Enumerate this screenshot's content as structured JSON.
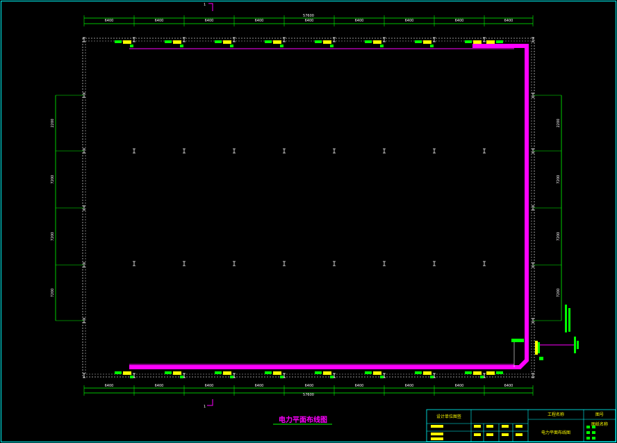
{
  "drawing": {
    "title": "电力平面布线图",
    "background": "#000000",
    "colors": {
      "border": "#00ffff",
      "dimension": "#00ff00",
      "cable": "#ff00ff",
      "equipment_a": "#ffff00",
      "equipment_b": "#00ff00",
      "text": "#ffffff"
    }
  },
  "dimensions": {
    "top_total": "57600",
    "bottom_total": "57600",
    "top_spans": [
      "6400",
      "6400",
      "6400",
      "6400",
      "6400",
      "6400",
      "6400",
      "6400",
      "6400"
    ],
    "bottom_spans": [
      "6400",
      "6400",
      "6400",
      "6400",
      "6400",
      "6400",
      "6400",
      "6400",
      "6400"
    ],
    "left_spans": [
      "2200",
      "7200",
      "7200",
      "7200"
    ],
    "right_spans": [
      "2200",
      "7200",
      "7200",
      "7200"
    ]
  },
  "section_marks": {
    "top": "1",
    "bottom": "1"
  },
  "title_block": {
    "project_label": "工程名称",
    "drawing_label": "图纸名称",
    "drawing_name": "电力平面布线图",
    "stamp_label": "设计单位图签",
    "page_label": "图号"
  }
}
